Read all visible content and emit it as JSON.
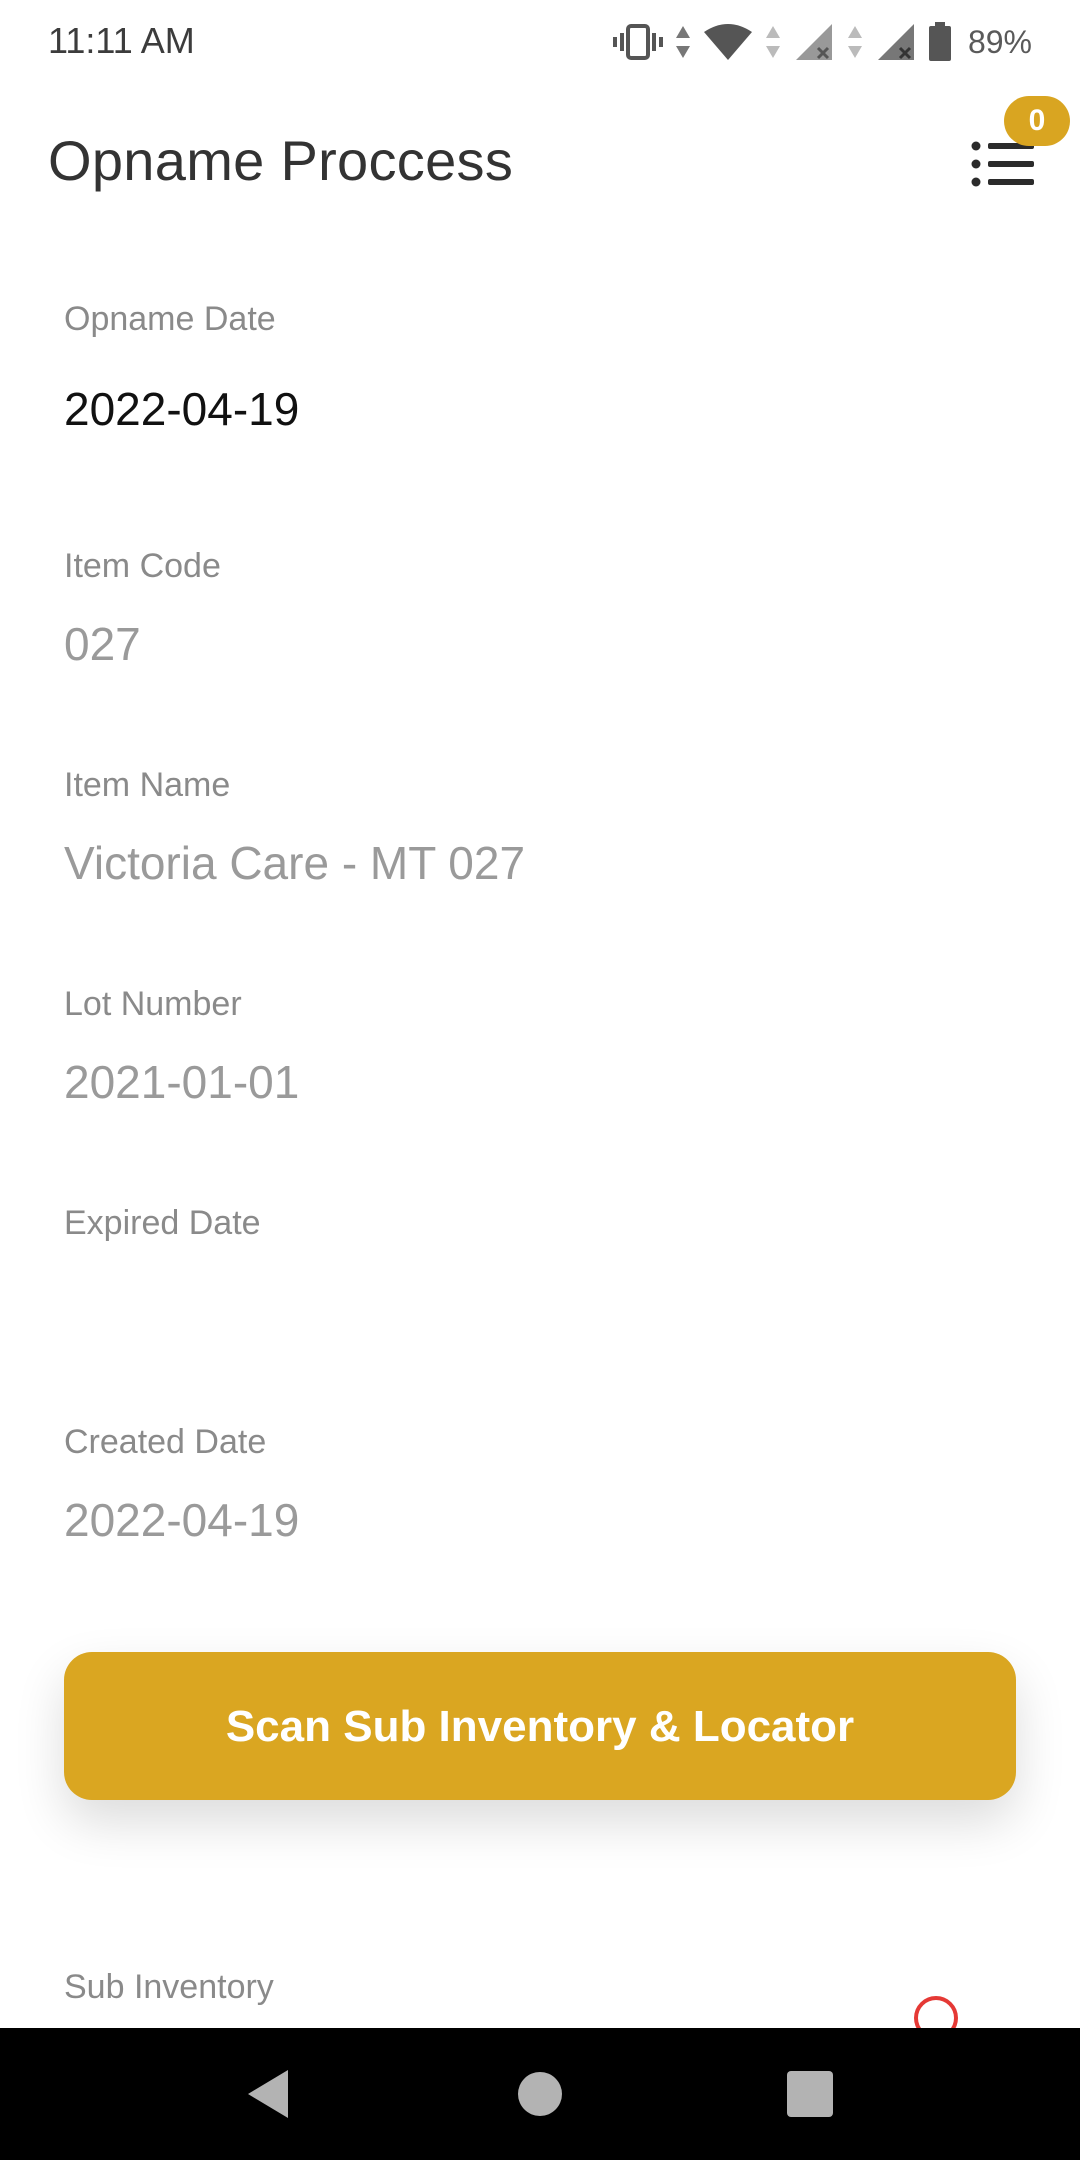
{
  "status_bar": {
    "time": "11:11 AM",
    "battery": "89%",
    "icons": [
      "vibrate-icon",
      "data-arrows-icon",
      "wifi-icon",
      "signal-x-icon",
      "signal-x-icon",
      "battery-icon"
    ]
  },
  "header": {
    "title": "Opname Proccess",
    "badge_count": "0",
    "menu_icon": "list-icon"
  },
  "fields": {
    "opname_date": {
      "label": "Opname Date",
      "value": "2022-04-19"
    },
    "item_code": {
      "label": "Item Code",
      "value": "027"
    },
    "item_name": {
      "label": "Item Name",
      "value": "Victoria Care - MT 027"
    },
    "lot_number": {
      "label": "Lot Number",
      "value": "2021-01-01"
    },
    "expired_date": {
      "label": "Expired Date",
      "value": ""
    },
    "created_date": {
      "label": "Created Date",
      "value": "2022-04-19"
    },
    "sub_inventory": {
      "label": "Sub Inventory"
    }
  },
  "actions": {
    "scan_label": "Scan Sub Inventory & Locator"
  },
  "nav_bar": {
    "icons": [
      "back-icon",
      "home-icon",
      "recents-icon"
    ]
  },
  "colors": {
    "accent": "#daa621",
    "spinner": "#e53935"
  }
}
